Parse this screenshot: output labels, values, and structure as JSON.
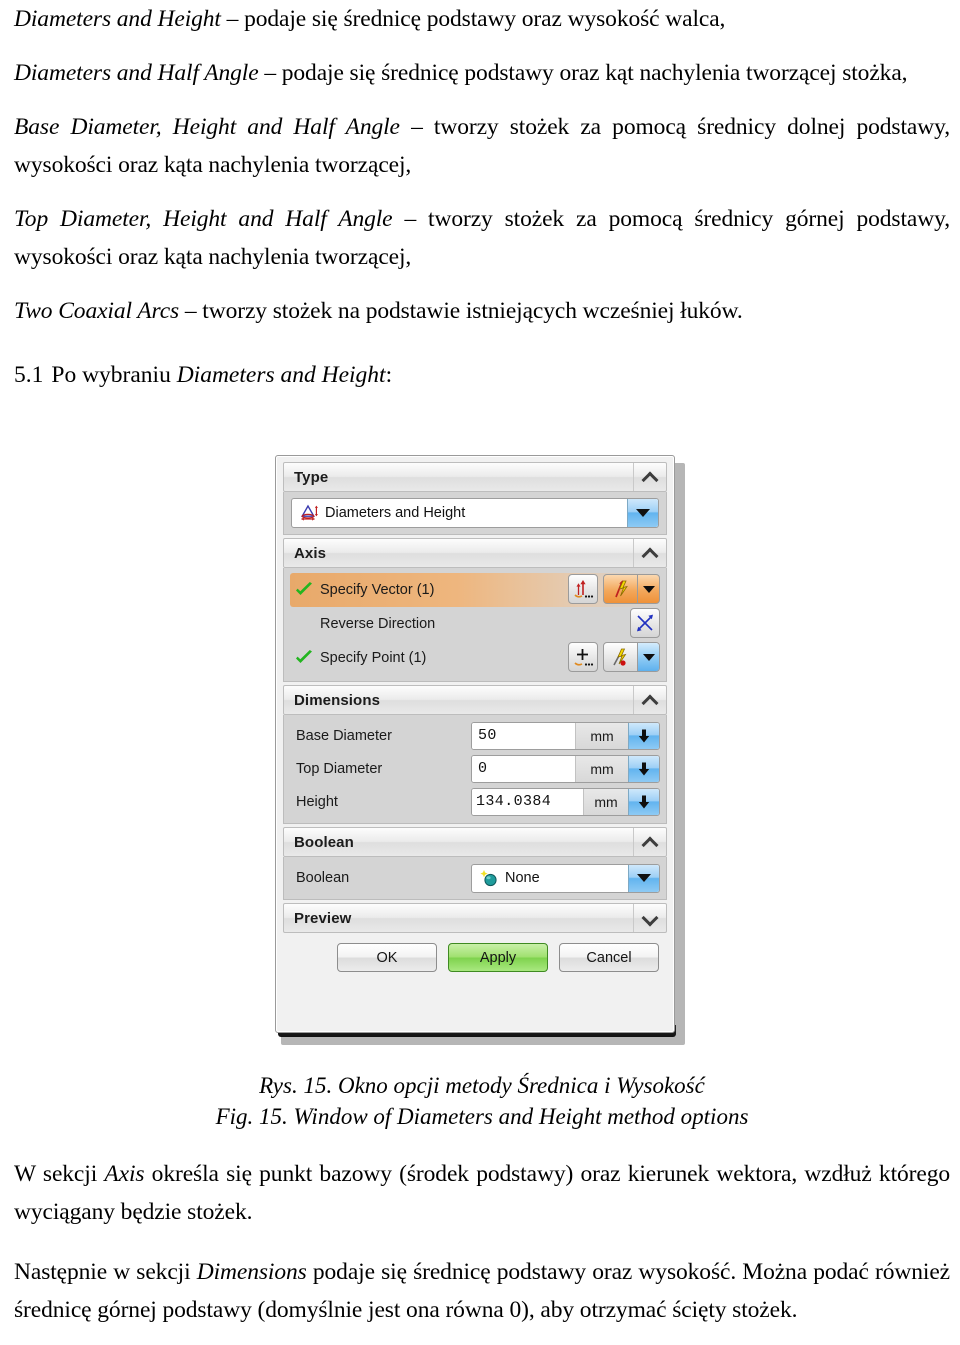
{
  "document": {
    "paragraphs": [
      {
        "id": "p1",
        "term": "Diameters and Height",
        "text": " – podaje się średnicę podstawy oraz wysokość walca,"
      },
      {
        "id": "p2",
        "term": "Diameters and Half Angle",
        "text": " – podaje się średnicę podstawy oraz kąt nachylenia tworzącej stożka,"
      },
      {
        "id": "p3",
        "term": "Base Diameter, Height and Half Angle",
        "text": " – tworzy stożek za pomocą średnicy dolnej podstawy, wysokości oraz kąta nachylenia tworzącej,"
      },
      {
        "id": "p4",
        "term": "Top Diameter, Height and Half Angle",
        "text": " – tworzy stożek za pomocą średnicy górnej podstawy, wysokości oraz kąta nachylenia tworzącej,"
      },
      {
        "id": "p5",
        "term": "Two Coaxial Arcs",
        "text": " – tworzy stożek na podstawie istniejących wcześniej łuków."
      }
    ],
    "section_heading": {
      "number": "5.1",
      "text_before": "Po wybraniu ",
      "term": "Diameters and Height",
      "text_after": ":"
    },
    "figure_caption": {
      "line_pl": "Rys. 15. Okno opcji metody Średnica i Wysokość",
      "line_en": "Fig. 15. Window of Diameters and Height method options"
    },
    "closing_paragraphs": [
      {
        "id": "c1",
        "before": "W sekcji ",
        "term": "Axis",
        "after": " określa się punkt bazowy (środek podstawy) oraz kierunek wektora, wzdłuż którego wyciągany będzie stożek."
      },
      {
        "id": "c2",
        "before": "Następnie w sekcji ",
        "term": "Dimensions",
        "after": " podaje się średnicę podstawy oraz wysokość. Można podać również średnicę górnej podstawy (domyślnie jest ona równa 0), aby otrzymać ścięty stożek."
      }
    ]
  },
  "dialog": {
    "groups": {
      "type": {
        "title": "Type",
        "collapse_state": "expanded",
        "combo": {
          "value": "Diameters and Height",
          "icon": "cone-diameter-height-icon"
        }
      },
      "axis": {
        "title": "Axis",
        "collapse_state": "expanded",
        "rows": [
          {
            "label": "Specify Vector (1)",
            "status": "checked",
            "selected": true,
            "icon": "vector-constructor-icon",
            "tool_icon": "vector-inference-icon",
            "has_dropdown": true
          },
          {
            "label": "Reverse Direction",
            "status": "none",
            "selected": false,
            "tool_icon": "reverse-direction-icon",
            "has_dropdown": false
          },
          {
            "label": "Specify Point (1)",
            "status": "checked",
            "selected": false,
            "icon": "point-constructor-icon",
            "tool_icon": "point-inference-icon",
            "has_dropdown": true
          }
        ]
      },
      "dimensions": {
        "title": "Dimensions",
        "collapse_state": "expanded",
        "fields": [
          {
            "label": "Base Diameter",
            "value": "50",
            "unit": "mm"
          },
          {
            "label": "Top Diameter",
            "value": "0",
            "unit": "mm"
          },
          {
            "label": "Height",
            "value": "134.0384",
            "unit": "mm"
          }
        ]
      },
      "boolean": {
        "title": "Boolean",
        "collapse_state": "expanded",
        "row_label": "Boolean",
        "combo": {
          "value": "None",
          "icon": "boolean-none-icon"
        }
      },
      "preview": {
        "title": "Preview",
        "collapse_state": "collapsed"
      }
    },
    "footer": {
      "ok_label": "OK",
      "apply_label": "Apply",
      "cancel_label": "Cancel"
    },
    "colors": {
      "selected_row": "#eeb67e",
      "apply_button": "#9ee06d",
      "combo_arrow": "#62b4ef",
      "check_green": "#23b520"
    }
  }
}
